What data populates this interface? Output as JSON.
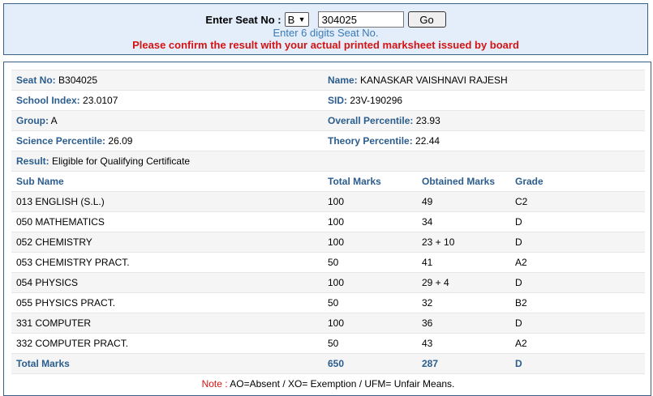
{
  "search": {
    "label": "Enter Seat No :",
    "series_value": "B",
    "seat_value": "304025",
    "go_label": "Go",
    "hint": "Enter 6 digits Seat No.",
    "warning": "Please confirm the result with your actual printed marksheet issued by board"
  },
  "student": {
    "seat_label": "Seat No:",
    "seat": "B304025",
    "name_label": "Name:",
    "name": "KANASKAR VAISHNAVI RAJESH",
    "school_label": "School Index:",
    "school": "23.0107",
    "sid_label": "SID:",
    "sid": "23V-190296",
    "group_label": "Group:",
    "group": "A",
    "overall_label": "Overall Percentile:",
    "overall": "23.93",
    "science_label": "Science Percentile:",
    "science": "26.09",
    "theory_label": "Theory Percentile:",
    "theory": "22.44",
    "result_label": "Result:",
    "result": "Eligible for Qualifying Certificate"
  },
  "marks": {
    "headers": [
      "Sub Name",
      "Total Marks",
      "Obtained Marks",
      "Grade"
    ],
    "rows": [
      [
        "013 ENGLISH (S.L.)",
        "100",
        "49",
        "C2"
      ],
      [
        "050 MATHEMATICS",
        "100",
        "34",
        "D"
      ],
      [
        "052 CHEMISTRY",
        "100",
        "23 + 10",
        "D"
      ],
      [
        "053 CHEMISTRY PRACT.",
        "50",
        "41",
        "A2"
      ],
      [
        "054 PHYSICS",
        "100",
        "29 + 4",
        "D"
      ],
      [
        "055 PHYSICS PRACT.",
        "50",
        "32",
        "B2"
      ],
      [
        "331 COMPUTER",
        "100",
        "36",
        "D"
      ],
      [
        "332 COMPUTER PRACT.",
        "50",
        "43",
        "A2"
      ]
    ],
    "total": [
      "Total Marks",
      "650",
      "287",
      "D"
    ]
  },
  "note": {
    "label": "Note :",
    "text": "AO=Absent / XO= Exemption / UFM= Unfair Means."
  }
}
